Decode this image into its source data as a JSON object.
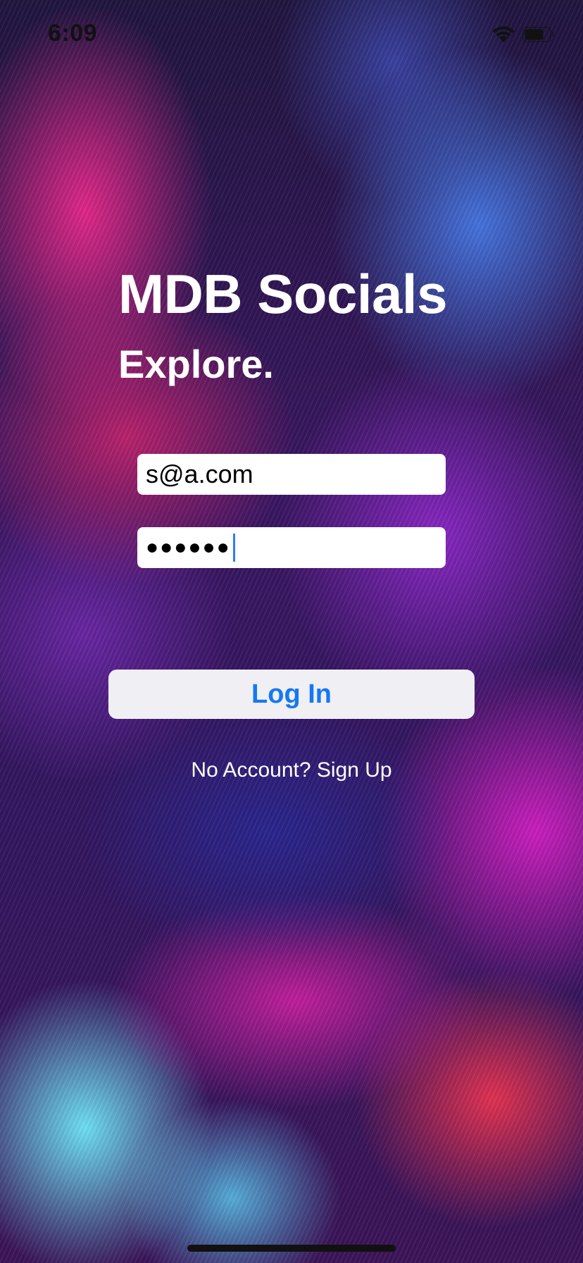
{
  "status_bar": {
    "time": "6:09",
    "icons": [
      "wifi-icon",
      "battery-icon"
    ]
  },
  "app": {
    "title": "MDB Socials",
    "subtitle": "Explore."
  },
  "login_form": {
    "email_value": "s@a.com",
    "password_value": "●●●●●●",
    "login_label": "Log In",
    "signup_label": "No Account? Sign Up"
  },
  "colors": {
    "button_background": "#efeff4",
    "button_text": "#1478f2",
    "cursor": "#2f7cf6"
  }
}
